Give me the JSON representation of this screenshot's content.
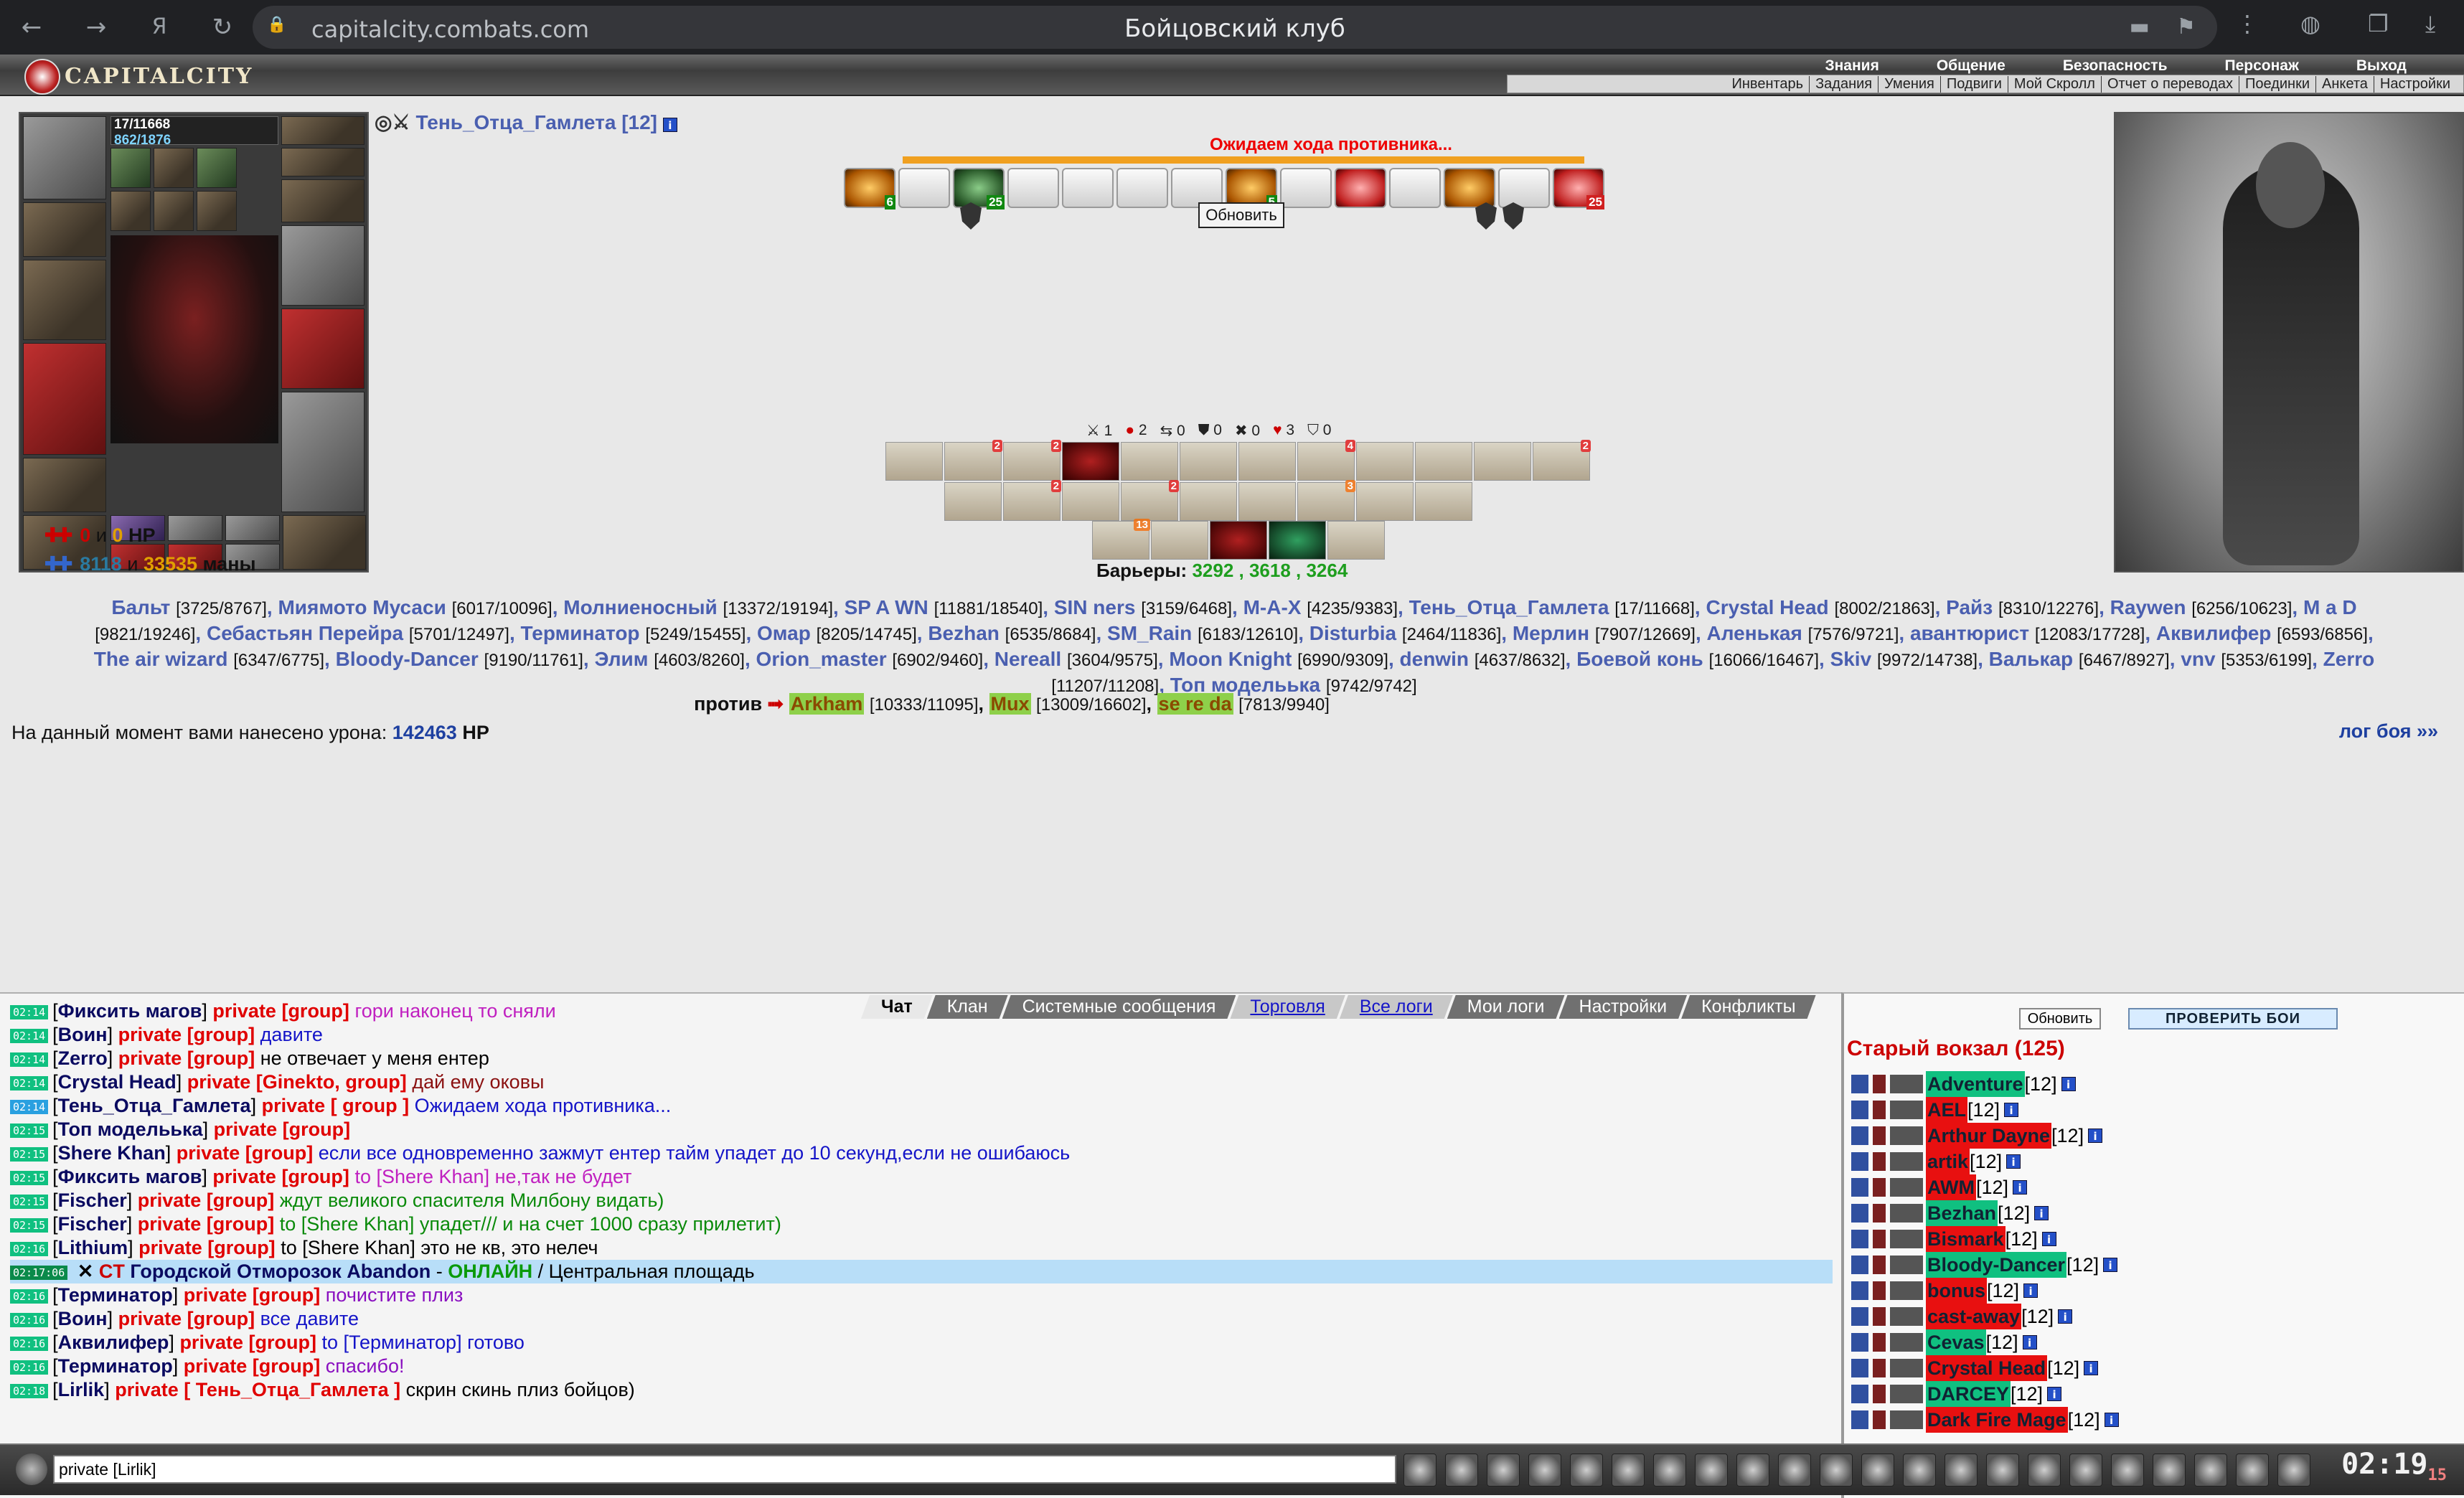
{
  "browser": {
    "url": "capitalcity.combats.com",
    "title": "Бойцовский клуб"
  },
  "logo": {
    "text": "CAPITALCITY"
  },
  "topmenu": [
    "Знания",
    "Общение",
    "Безопасность",
    "Персонаж",
    "Выход"
  ],
  "submenu": [
    "Инвентарь",
    "Задания",
    "Умения",
    "Подвиги",
    "Мой Скролл",
    "Отчет о переводах",
    "Поединки",
    "Анкета",
    "Настройки"
  ],
  "player": {
    "hp": "17/11668",
    "mana": "862/1876",
    "name": "Тень_Отца_Гамлета [12]",
    "stat_hp_a": "0",
    "stat_hp_and": "и",
    "stat_hp_b": "0",
    "stat_hp_unit": "HP",
    "stat_mana_a": "8118",
    "stat_mana_and": "и",
    "stat_mana_b": "33535",
    "stat_mana_unit": "маны"
  },
  "battle": {
    "waiting": "Ожидаем хода противника...",
    "refresh": "Обновить",
    "slot_counts": [
      "6",
      "25",
      "5",
      "25"
    ],
    "counters": [
      "1",
      "2",
      "0",
      "0",
      "0",
      "3",
      "0"
    ],
    "barriers_label": "Барьеры:",
    "barriers_values": "3292 , 3618 , 3264",
    "effect_counts": {
      "r1": [
        "2",
        "2",
        "4",
        "2"
      ],
      "r2": [
        "2",
        "2",
        "3"
      ],
      "r3": [
        "13"
      ]
    },
    "damage_label": "На данный момент вами нанесено урона:",
    "damage_value": "142463",
    "damage_unit": "HP",
    "log_link": "лог боя »»",
    "vs_label": "против"
  },
  "allies": [
    {
      "n": "Бальт",
      "v": "[3725/8767]"
    },
    {
      "n": "Миямото Мусаси",
      "v": "[6017/10096]"
    },
    {
      "n": "Молниеносный",
      "v": "[13372/19194]"
    },
    {
      "n": "SP A WN",
      "v": "[11881/18540]"
    },
    {
      "n": "SIN ners",
      "v": "[3159/6468]"
    },
    {
      "n": "M-A-X",
      "v": "[4235/9383]"
    },
    {
      "n": "Тень_Отца_Гамлета",
      "v": "[17/11668]"
    },
    {
      "n": "Crystal Head",
      "v": "[8002/21863]"
    },
    {
      "n": "Райз",
      "v": "[8310/12276]"
    },
    {
      "n": "Raywen",
      "v": "[6256/10623]"
    },
    {
      "n": "M a D",
      "v": "[9821/19246]"
    },
    {
      "n": "Себастьян Перейра",
      "v": "[5701/12497]"
    },
    {
      "n": "Терминатор",
      "v": "[5249/15455]"
    },
    {
      "n": "Омар",
      "v": "[8205/14745]"
    },
    {
      "n": "Bezhan",
      "v": "[6535/8684]"
    },
    {
      "n": "SM_Rain",
      "v": "[6183/12610]"
    },
    {
      "n": "Disturbia",
      "v": "[2464/11836]"
    },
    {
      "n": "Мерлин",
      "v": "[7907/12669]"
    },
    {
      "n": "Аленькая",
      "v": "[7576/9721]"
    },
    {
      "n": "авантюрист",
      "v": "[12083/17728]"
    },
    {
      "n": "Аквилифер",
      "v": "[6593/6856]"
    },
    {
      "n": "The air wizard",
      "v": "[6347/6775]"
    },
    {
      "n": "Bloody-Dancer",
      "v": "[9190/11761]"
    },
    {
      "n": "Элим",
      "v": "[4603/8260]"
    },
    {
      "n": "Orion_master",
      "v": "[6902/9460]"
    },
    {
      "n": "Nereall",
      "v": "[3604/9575]"
    },
    {
      "n": "Moon Knight",
      "v": "[6990/9309]"
    },
    {
      "n": "denwin",
      "v": "[4637/8632]"
    },
    {
      "n": "Боевой конь",
      "v": "[16066/16467]"
    },
    {
      "n": "Skiv",
      "v": "[9972/14738]"
    },
    {
      "n": "Валькар",
      "v": "[6467/8927]"
    },
    {
      "n": "vnv",
      "v": "[5353/6199]"
    },
    {
      "n": "Zerro",
      "v": "[11207/11208]"
    },
    {
      "n": "Топ модельька",
      "v": "[9742/9742]"
    }
  ],
  "enemies": [
    {
      "n": "Arkham",
      "v": "[10333/11095]"
    },
    {
      "n": "Mux",
      "v": "[13009/16602]"
    },
    {
      "n": "se re da",
      "v": "[7813/9940]"
    }
  ],
  "chat": {
    "tabs": [
      "Чат",
      "Клан",
      "Системные сообщения",
      "Торговля",
      "Все логи",
      "Мои логи",
      "Настройки",
      "Конфликты"
    ],
    "lines": [
      {
        "t": "02:14",
        "n": "Фикcить магов",
        "p": "private [group]",
        "m": "гори наконец то сняли",
        "c": "#c020c0"
      },
      {
        "t": "02:14",
        "n": "Воин",
        "p": "private [group]",
        "m": "давите",
        "c": "#1414c8"
      },
      {
        "t": "02:14",
        "n": "Zerro",
        "p": "private [group]",
        "m": "не отвечает у меня ентер",
        "c": "#000"
      },
      {
        "t": "02:14",
        "n": "Crystal Head",
        "p": "private [Ginekto, group]",
        "m": "дай ему оковы",
        "c": "#8a1010"
      },
      {
        "t": "02:14",
        "n": "Тень_Отца_Гамлета",
        "p": "private [ group ]",
        "m": "Ожидаем хода противника...",
        "c": "#1414c8",
        "blue": true
      },
      {
        "t": "02:15",
        "n": "Топ модельька",
        "p": "private [group]",
        "m": "",
        "c": "#000"
      },
      {
        "t": "02:15",
        "n": "Shere Khan",
        "p": "private [group]",
        "m": "если все одновременно зажмут ентер тайм упадет до 10 секунд,если не ошибаюсь",
        "c": "#1414c8"
      },
      {
        "t": "02:15",
        "n": "Фикcить магов",
        "p": "private [group]",
        "m": "to [Shere Khan] не,так не будет",
        "c": "#c020c0"
      },
      {
        "t": "02:15",
        "n": "Fischer",
        "p": "private [group]",
        "m": "ждут великого спасителя Милбону видать)",
        "c": "#0a8a0a"
      },
      {
        "t": "02:15",
        "n": "Fischer",
        "p": "private [group]",
        "m": "to [Shere Khan] упадет/// и на счет 1000 сразу прилетит)",
        "c": "#0a8a0a"
      },
      {
        "t": "02:16",
        "n": "Lithium",
        "p": "private [group]",
        "m": "to [Shere Khan] это не кв, это нелеч",
        "c": "#000"
      }
    ],
    "system": {
      "t": "02:17:06",
      "tag": "CT",
      "who": "Городской Отморозок Abandon",
      "dash": "-",
      "status": "ОНЛАЙН",
      "place": "/ Центральная площадь"
    },
    "lines2": [
      {
        "t": "02:16",
        "n": "Терминатор",
        "p": "private [group]",
        "m": "почистите плиз",
        "c": "#8a10c0"
      },
      {
        "t": "02:16",
        "n": "Воин",
        "p": "private [group]",
        "m": "все давите",
        "c": "#1414c8"
      },
      {
        "t": "02:16",
        "n": "Аквилифер",
        "p": "private [group]",
        "m": "to [Терминатор] готово",
        "c": "#1414c8"
      },
      {
        "t": "02:16",
        "n": "Терминатор",
        "p": "private [group]",
        "m": "спасибо!",
        "c": "#8a10c0"
      },
      {
        "t": "02:18",
        "n": "Lirlik",
        "p": "private [ Тень_Отца_Гамлета ]",
        "m": "скрин скинь плиз бойцов)",
        "c": "#000"
      }
    ],
    "input": "private [Lirlik]"
  },
  "right": {
    "refresh": "Обновить",
    "check": "ПРОВЕРИТЬ БОИ",
    "location": "Старый вокзал (125)",
    "players": [
      {
        "n": "Adventure",
        "c": "g"
      },
      {
        "n": "AEL",
        "c": "r"
      },
      {
        "n": "Arthur Dayne",
        "c": "r"
      },
      {
        "n": "artik",
        "c": "r"
      },
      {
        "n": "AWM",
        "c": "r"
      },
      {
        "n": "Bezhan",
        "c": "g"
      },
      {
        "n": "Bismark",
        "c": "r"
      },
      {
        "n": "Bloody-Dancer",
        "c": "g"
      },
      {
        "n": "bonus",
        "c": "r"
      },
      {
        "n": "cast-away",
        "c": "r"
      },
      {
        "n": "Cevas",
        "c": "g"
      },
      {
        "n": "Crystal Head",
        "c": "r"
      },
      {
        "n": "DARCEY",
        "c": "g"
      },
      {
        "n": "Dark Fire Mage",
        "c": "r"
      }
    ],
    "level": "[12]"
  },
  "clock": {
    "time": "02:19",
    "sec": "15"
  }
}
